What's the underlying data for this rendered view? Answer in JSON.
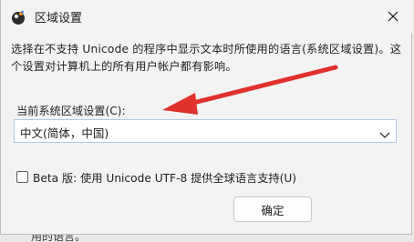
{
  "window": {
    "title": "区域设置",
    "icon": "region-globe-icon",
    "close_glyph": "✕"
  },
  "description": "选择在不支持 Unicode 的程序中显示文本时所使用的语言(系统区域设置)。这个设置对计算机上的所有用户帐户都有影响。",
  "locale": {
    "label": "当前系统区域设置(C):",
    "selected": "中文(简体，中国)"
  },
  "beta_option": {
    "label": "Beta 版: 使用 Unicode UTF-8 提供全球语言支持(U)",
    "checked": false
  },
  "buttons": {
    "ok": "确定"
  },
  "background": {
    "partial_text": "用的语言。"
  },
  "annotation": {
    "arrow_color": "#e0312d"
  }
}
